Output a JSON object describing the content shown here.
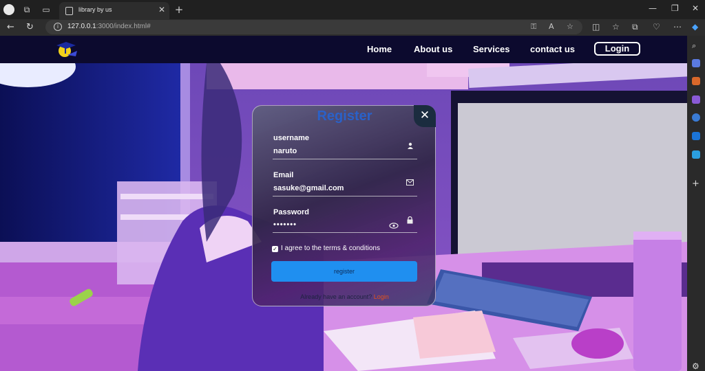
{
  "browser": {
    "tab_title": "library by us",
    "tab_close": "✕",
    "new_tab": "+",
    "url_host": "127.0.0.1",
    "url_rest": ":3000/index.html#"
  },
  "site": {
    "nav_links": [
      "Home",
      "About us",
      "Services",
      "contact us"
    ],
    "login_button": "Login"
  },
  "register_form": {
    "title": "Register",
    "close_symbol": "✕",
    "username_label": "username",
    "username_value": "naruto",
    "email_label": "Email",
    "email_value": "sasuke@gmail.com",
    "password_label": "Password",
    "password_value": "•••••••",
    "agree_text": "I agree to the terms & conditions",
    "agree_checked": true,
    "submit_label": "register",
    "footer_text": "Already have an account?",
    "footer_link": "Login"
  },
  "colors": {
    "title": "#2a61c9",
    "register_button": "#1f8ff0",
    "login_link": "#e2521c",
    "nav_bg": "#0c0a2e"
  },
  "icons": {
    "username": "person-icon",
    "email": "envelope-icon",
    "password": "lock-icon",
    "toggle": "eye-icon"
  }
}
